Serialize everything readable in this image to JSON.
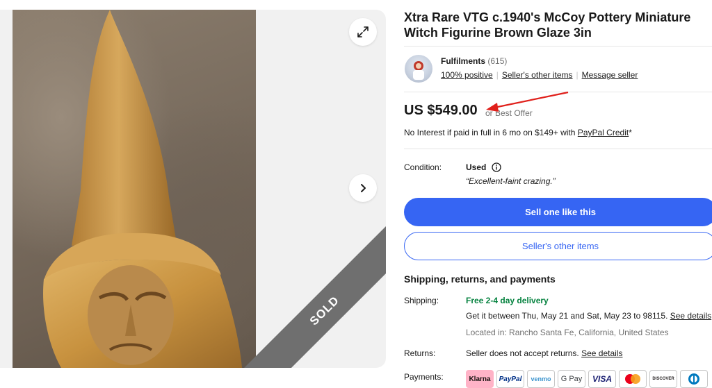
{
  "listing": {
    "title": "Xtra Rare VTG c.1940's McCoy Pottery Miniature Witch Figurine Brown Glaze 3in",
    "sold_label": "SOLD"
  },
  "seller": {
    "name": "Fulfilments",
    "feedback_count": "(615)",
    "positive": "100% positive",
    "other_items": "Seller's other items",
    "message": "Message seller"
  },
  "price": {
    "amount": "US $549.00",
    "best_offer": "or Best Offer",
    "financing_text": "No Interest if paid in full in 6 mo on $149+ with",
    "financing_link": "PayPal Credit",
    "financing_suffix": "*"
  },
  "condition": {
    "label": "Condition:",
    "value": "Used",
    "quote": "“Excellent-faint crazing.”"
  },
  "actions": {
    "sell_one": "Sell one like this",
    "seller_other_items": "Seller's other items"
  },
  "shipping": {
    "heading": "Shipping, returns, and payments",
    "shipping_label": "Shipping:",
    "shipping_value": "Free 2-4 day delivery",
    "delivery_text": "Get it between Thu, May 21 and Sat, May 23 to 98115.",
    "see_details": "See details",
    "located": "Located in: Rancho Santa Fe, California, United States",
    "returns_label": "Returns:",
    "returns_text": "Seller does not accept returns.",
    "returns_link": "See details",
    "payments_label": "Payments:"
  },
  "payment_methods": [
    "Klarna",
    "PayPal",
    "venmo",
    "G Pay",
    "VISA",
    "mastercard",
    "DISCOVER",
    "Diners"
  ],
  "colors": {
    "primary_blue": "#3665f3",
    "green": "#05823f",
    "annotation_red": "#e0201b"
  }
}
